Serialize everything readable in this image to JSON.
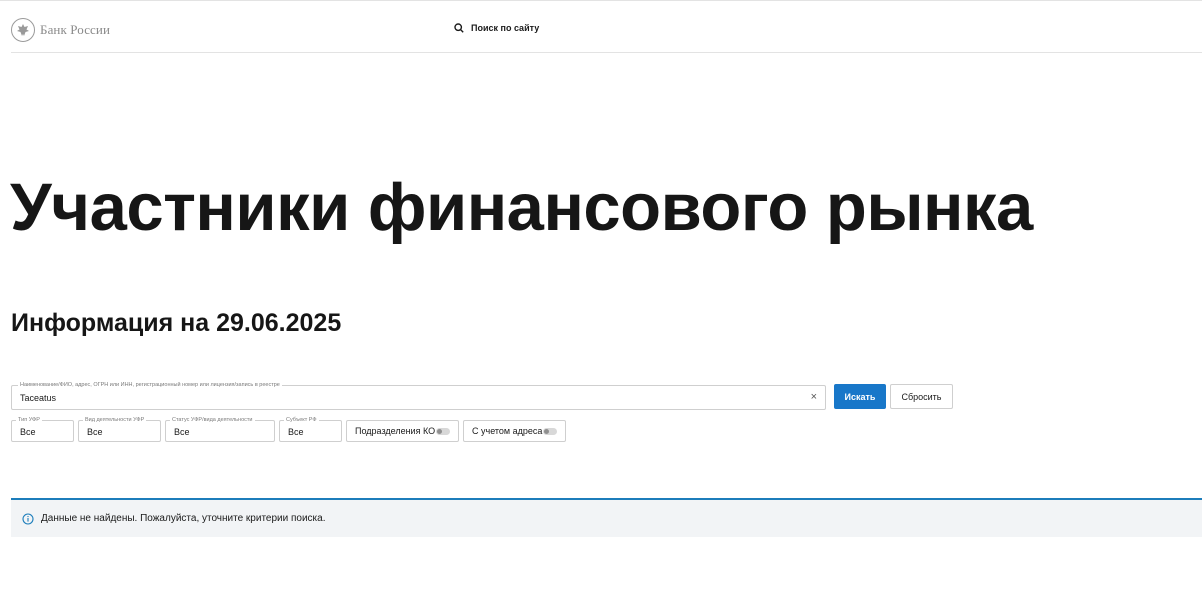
{
  "header": {
    "logo_text": "Банк России",
    "logo_icon": "eagle-emblem-icon",
    "search_icon": "magnifier-icon",
    "search_label": "Поиск по сайту"
  },
  "page": {
    "title": "Участники финансового рынка",
    "info_date": "Информация на 29.06.2025"
  },
  "search": {
    "legend": "Наименование/ФИО, адрес, ОГРН или ИНН, регистрационный номер или лицензия/запись в реестре",
    "value": "Taceatus",
    "clear_label": "×",
    "search_button": "Искать",
    "reset_button": "Сбросить"
  },
  "filters": [
    {
      "legend": "Тип УФР",
      "value": "Все"
    },
    {
      "legend": "Вид деятельности УФР",
      "value": "Все"
    },
    {
      "legend": "Статус УФР/вида деятельности",
      "value": "Все"
    },
    {
      "legend": "Субъект РФ",
      "value": "Все"
    }
  ],
  "toggles": [
    {
      "label": "Подразделения КО",
      "on": false
    },
    {
      "label": "С учетом адреса",
      "on": false
    }
  ],
  "notice": {
    "icon": "info-icon",
    "text": "Данные не найдены. Пожалуйста, уточните критерии поиска.",
    "accent_color": "#1c7dbb"
  },
  "colors": {
    "primary": "#1877c9",
    "notice_bg": "#f2f4f6"
  }
}
